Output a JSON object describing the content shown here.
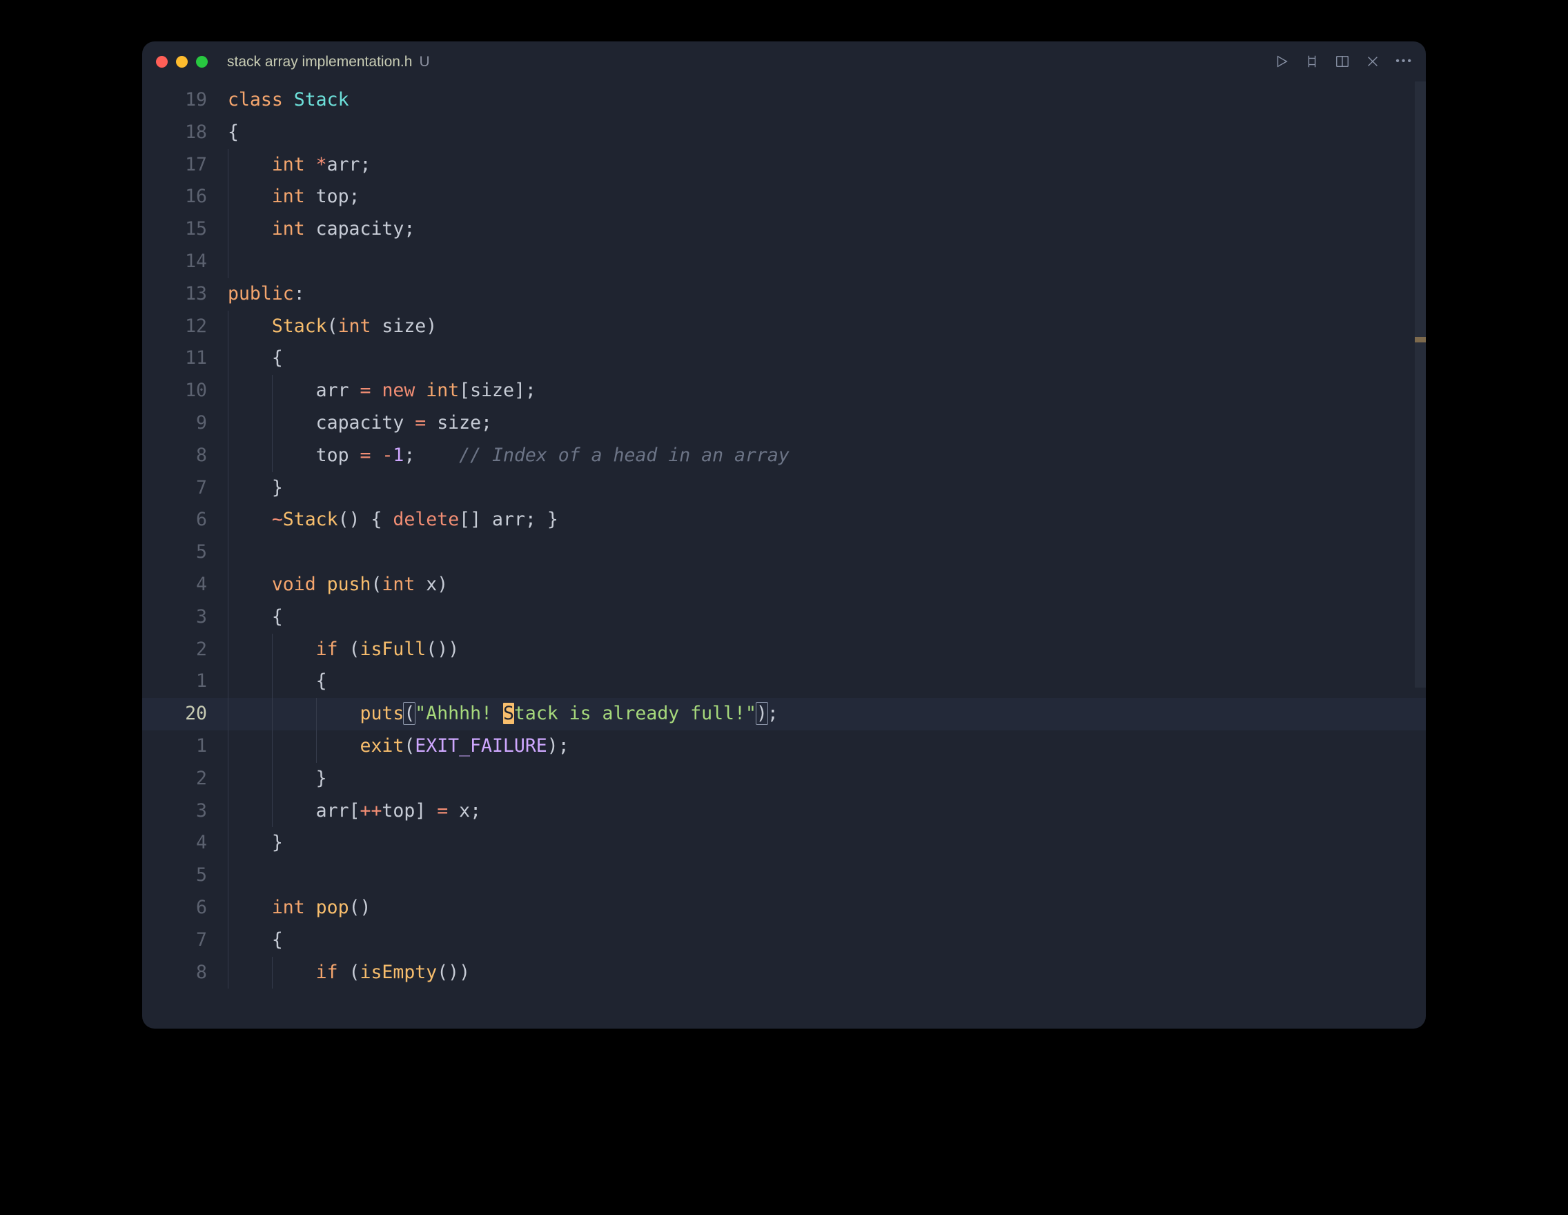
{
  "tab": {
    "filename": "stack array implementation.h",
    "dirty_indicator": "U"
  },
  "toolbar": {
    "run_icon": "run-icon",
    "compare_icon": "compare-icon",
    "split_icon": "split-editor-icon",
    "close_icon": "close-icon",
    "more_icon": "more-icon"
  },
  "gutter": [
    "19",
    "18",
    "17",
    "16",
    "15",
    "14",
    "13",
    "12",
    "11",
    "10",
    "9",
    "8",
    "7",
    "6",
    "5",
    "4",
    "3",
    "2",
    "1",
    "20",
    "1",
    "2",
    "3",
    "4",
    "5",
    "6",
    "7",
    "8"
  ],
  "highlighted_line_index": 19,
  "colors": {
    "keyword": "#f5a66e",
    "type": "#6de0da",
    "operator": "#f28e74",
    "function": "#f8be6d",
    "constant": "#cfa8ff",
    "string": "#a7d97c",
    "comment": "#6c7486",
    "background": "#1f2430"
  },
  "code": {
    "l0": {
      "class_kw": "class",
      "sp": " ",
      "name": "Stack"
    },
    "l1": {
      "brace": "{"
    },
    "l2": {
      "type": "int",
      "sp": " ",
      "star": "*",
      "id": "arr",
      "semi": ";"
    },
    "l3": {
      "type": "int",
      "sp": " ",
      "id": "top",
      "semi": ";"
    },
    "l4": {
      "type": "int",
      "sp": " ",
      "id": "capacity",
      "semi": ";"
    },
    "l5": {},
    "l6": {
      "kw": "public",
      "colon": ":"
    },
    "l7": {
      "name": "Stack",
      "lpar": "(",
      "ptype": "int",
      "sp": " ",
      "pid": "size",
      "rpar": ")"
    },
    "l8": {
      "brace": "{"
    },
    "l9": {
      "id": "arr",
      "sp": " ",
      "eq": "=",
      "sp2": " ",
      "new": "new",
      "sp3": " ",
      "type": "int",
      "lbr": "[",
      "sz": "size",
      "rbr": "]",
      "semi": ";"
    },
    "l10": {
      "id": "capacity",
      "sp": " ",
      "eq": "=",
      "sp2": " ",
      "sz": "size",
      "semi": ";"
    },
    "l11": {
      "id": "top",
      "sp": " ",
      "eq": "=",
      "sp2": " ",
      "neg": "-",
      "num": "1",
      "semi": ";",
      "gap": "    ",
      "comment": "// Index of a head in an array"
    },
    "l12": {
      "brace": "}"
    },
    "l13": {
      "tilde": "~",
      "name": "Stack",
      "lpar": "(",
      "rpar": ")",
      "sp": " ",
      "lb": "{",
      "sp2": " ",
      "del": "delete",
      "br": "[]",
      "sp3": " ",
      "id": "arr",
      "semi": ";",
      "sp4": " ",
      "rb": "}"
    },
    "l14": {},
    "l15": {
      "ret": "void",
      "sp": " ",
      "fn": "push",
      "lpar": "(",
      "ptype": "int",
      "sp2": " ",
      "pid": "x",
      "rpar": ")"
    },
    "l16": {
      "brace": "{"
    },
    "l17": {
      "if": "if",
      "sp": " ",
      "lpar": "(",
      "fn": "isFull",
      "lp2": "(",
      "rp2": ")",
      "rpar": ")"
    },
    "l18": {
      "brace": "{"
    },
    "l19": {
      "fn": "puts",
      "lpar": "(",
      "q1": "\"",
      "s1": "Ahhhh! ",
      "sh": "S",
      "s2": "tack is already full!",
      "q2": "\"",
      "rpar": ")",
      "semi": ";"
    },
    "l20": {
      "fn": "exit",
      "lpar": "(",
      "c": "EXIT_FAILURE",
      "rpar": ")",
      "semi": ";"
    },
    "l21": {
      "brace": "}"
    },
    "l22": {
      "id": "arr",
      "lbr": "[",
      "pp": "++",
      "tp": "top",
      "rbr": "]",
      "sp": " ",
      "eq": "=",
      "sp2": " ",
      "x": "x",
      "semi": ";"
    },
    "l23": {
      "brace": "}"
    },
    "l24": {},
    "l25": {
      "ret": "int",
      "sp": " ",
      "fn": "pop",
      "lpar": "(",
      "rpar": ")"
    },
    "l26": {
      "brace": "{"
    },
    "l27": {
      "if": "if",
      "sp": " ",
      "lpar": "(",
      "fn": "isEmpty",
      "lp2": "(",
      "rp2": ")",
      "rpar": ")"
    }
  }
}
